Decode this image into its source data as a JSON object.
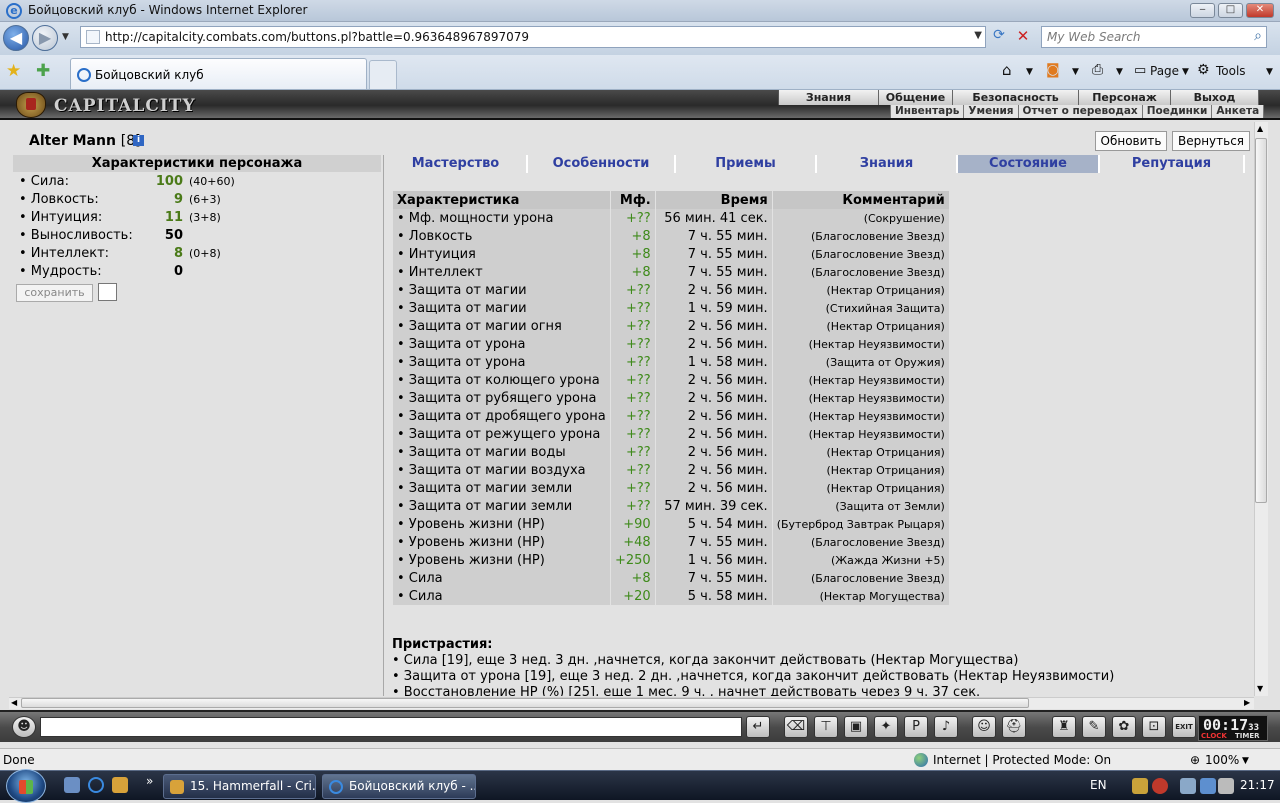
{
  "window": {
    "title": "Бойцовский клуб - Windows Internet Explorer",
    "controls": {
      "minimize": "‒",
      "maximize": "□",
      "close": "✕"
    }
  },
  "browser": {
    "url": "http://capitalcity.combats.com/buttons.pl?battle=0.963648967897079",
    "search_placeholder": "My Web Search",
    "tab_title": "Бойцовский клуб",
    "toolbar": {
      "page": "Page",
      "tools": "Tools"
    }
  },
  "game": {
    "logo_text": "CAPITALCITY",
    "menu_top": [
      "Знания",
      "Общение",
      "Безопасность",
      "Персонаж",
      "Выход"
    ],
    "menu_sub": [
      "Инвентарь",
      "Умения",
      "Отчет о переводах",
      "Поединки",
      "Анкета"
    ]
  },
  "character": {
    "name": "Alter Mann",
    "level": "[8]",
    "info_icon": "i",
    "refresh_label": "Обновить",
    "back_label": "Вернуться",
    "stats_title": "Характеристики персонажа",
    "stats": [
      {
        "name": "• Сила:",
        "value": "100",
        "extra": "(40+60)"
      },
      {
        "name": "• Ловкость:",
        "value": "9",
        "extra": "(6+3)"
      },
      {
        "name": "• Интуиция:",
        "value": "11",
        "extra": "(3+8)"
      },
      {
        "name": "• Выносливость:",
        "value": "50",
        "extra": ""
      },
      {
        "name": "• Интеллект:",
        "value": "8",
        "extra": "(0+8)"
      },
      {
        "name": "• Мудрость:",
        "value": "0",
        "extra": ""
      }
    ],
    "save_label": "сохранить"
  },
  "content_tabs": [
    "Мастерство",
    "Особенности",
    "Приемы",
    "Знания",
    "Состояние",
    "Репутация"
  ],
  "active_tab": "Состояние",
  "effects_table": {
    "headers": [
      "Характеристика",
      "Мф.",
      "Время",
      "Комментарий"
    ],
    "rows": [
      [
        "• Мф. мощности урона",
        "+??",
        "56 мин. 41 сек.",
        "(Сокрушение)"
      ],
      [
        "• Ловкость",
        "+8",
        "7 ч. 55 мин.",
        "(Благословение Звезд)"
      ],
      [
        "• Интуиция",
        "+8",
        "7 ч. 55 мин.",
        "(Благословение Звезд)"
      ],
      [
        "• Интеллект",
        "+8",
        "7 ч. 55 мин.",
        "(Благословение Звезд)"
      ],
      [
        "• Защита от магии",
        "+??",
        "2 ч. 56 мин.",
        "(Нектар Отрицания)"
      ],
      [
        "• Защита от магии",
        "+??",
        "1 ч. 59 мин.",
        "(Стихийная Защита)"
      ],
      [
        "• Защита от магии огня",
        "+??",
        "2 ч. 56 мин.",
        "(Нектар Отрицания)"
      ],
      [
        "• Защита от урона",
        "+??",
        "2 ч. 56 мин.",
        "(Нектар Неуязвимости)"
      ],
      [
        "• Защита от урона",
        "+??",
        "1 ч. 58 мин.",
        "(Защита от Оружия)"
      ],
      [
        "• Защита от колющего урона",
        "+??",
        "2 ч. 56 мин.",
        "(Нектар Неуязвимости)"
      ],
      [
        "• Защита от рубящего урона",
        "+??",
        "2 ч. 56 мин.",
        "(Нектар Неуязвимости)"
      ],
      [
        "• Защита от дробящего урона",
        "+??",
        "2 ч. 56 мин.",
        "(Нектар Неуязвимости)"
      ],
      [
        "• Защита от режущего урона",
        "+??",
        "2 ч. 56 мин.",
        "(Нектар Неуязвимости)"
      ],
      [
        "• Защита от магии воды",
        "+??",
        "2 ч. 56 мин.",
        "(Нектар Отрицания)"
      ],
      [
        "• Защита от магии воздуха",
        "+??",
        "2 ч. 56 мин.",
        "(Нектар Отрицания)"
      ],
      [
        "• Защита от магии земли",
        "+??",
        "2 ч. 56 мин.",
        "(Нектар Отрицания)"
      ],
      [
        "• Защита от магии земли",
        "+??",
        "57 мин. 39 сек.",
        "(Защита от Земли)"
      ],
      [
        "• Уровень жизни (HP)",
        "+90",
        "5 ч. 54 мин.",
        "(Бутерброд Завтрак Рыцаря)"
      ],
      [
        "• Уровень жизни (HP)",
        "+48",
        "7 ч. 55 мин.",
        "(Благословение Звезд)"
      ],
      [
        "• Уровень жизни (HP)",
        "+250",
        "1 ч. 56 мин.",
        "(Жажда Жизни +5)"
      ],
      [
        "• Сила",
        "+8",
        "7 ч. 55 мин.",
        "(Благословение Звезд)"
      ],
      [
        "• Сила",
        "+20",
        "5 ч. 58 мин.",
        "(Нектар Могущества)"
      ]
    ]
  },
  "addictions": {
    "title": "Пристрастия:",
    "lines": [
      "• Сила [19], еще 3 нед. 3 дн. ,начнется, когда закончит действовать (Нектар Могущества)",
      "• Защита от урона [19], еще 3 нед. 2 дн. ,начнется, когда закончит действовать (Нектар Неуязвимости)",
      "• Восстановление HP (%) [25], еще 1 мес. 9 ч. , начнет действовать через 9 ч. 37 сек."
    ]
  },
  "chat": {
    "clock_time": "00:17",
    "clock_sec": "33",
    "clock_label": "CLOCK",
    "timer_label": "TIMER",
    "exit_label": "EXIT"
  },
  "statusbar": {
    "left": "Done",
    "zone": "Internet | Protected Mode: On",
    "zoom": "100%"
  },
  "taskbar": {
    "items": [
      "15. Hammerfall - Cri...",
      "Бойцовский клуб - ..."
    ],
    "lang": "EN",
    "time": "21:17",
    "more": "»"
  },
  "icons": {
    "back": "arrow-left-icon",
    "forward": "arrow-right-icon",
    "refresh": "refresh-icon",
    "stop": "stop-icon",
    "search": "search-icon",
    "favorites": "star-icon"
  }
}
